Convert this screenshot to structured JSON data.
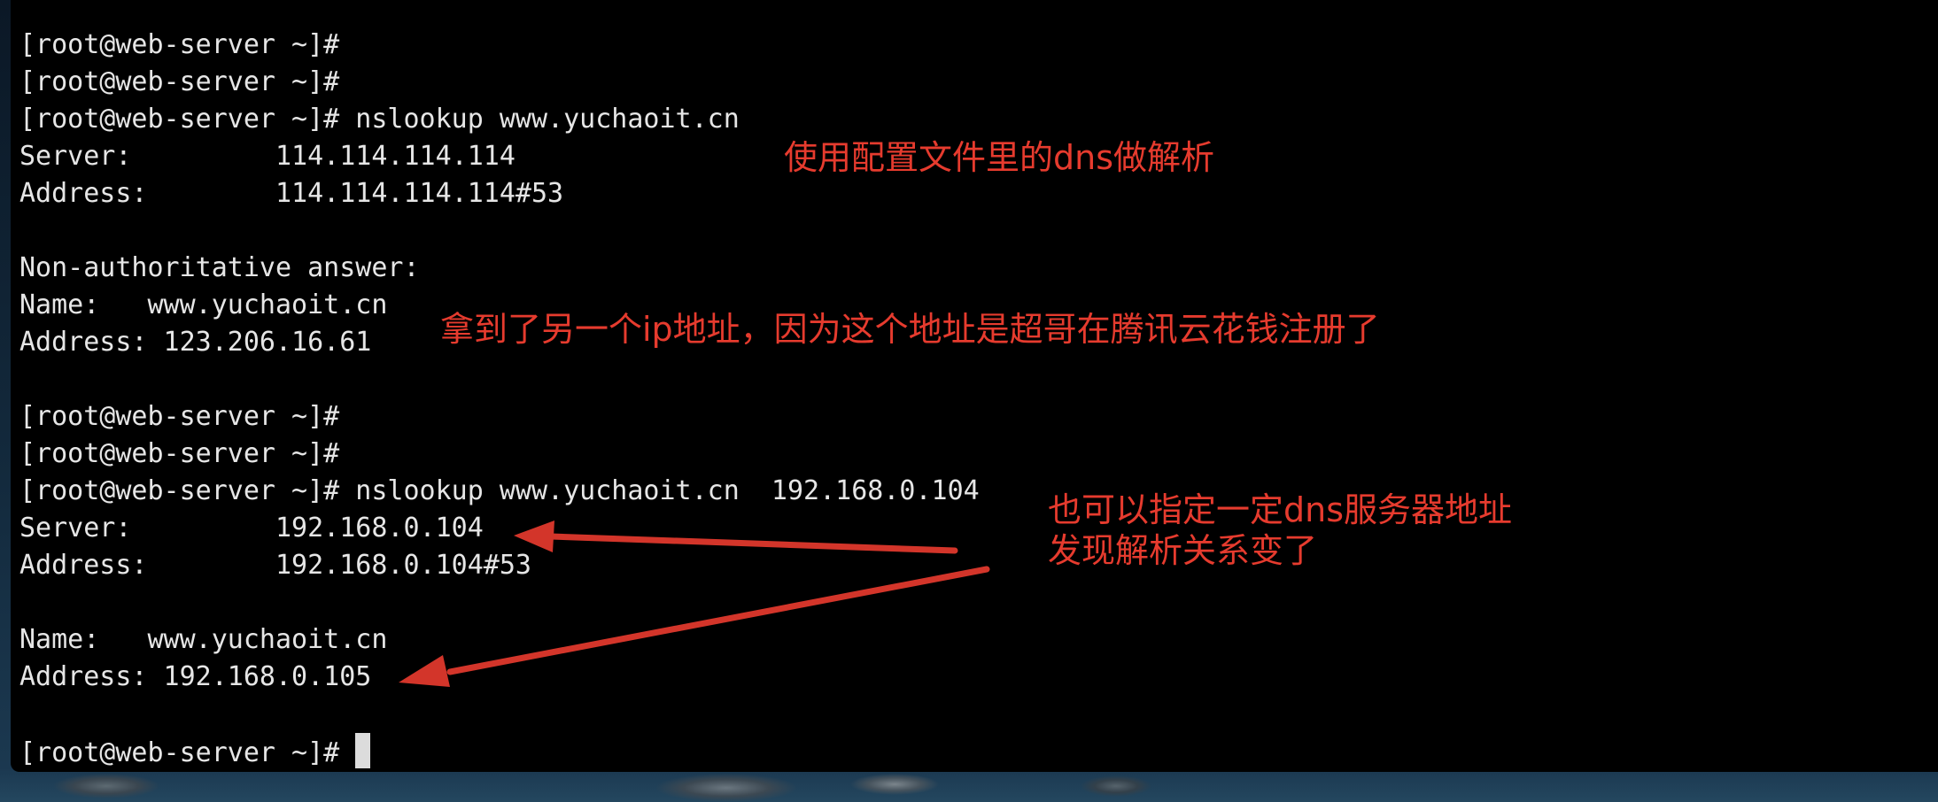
{
  "terminal": {
    "prompt": "[root@web-server ~]#",
    "lines": [
      "[root@web-server ~]#",
      "[root@web-server ~]#",
      "[root@web-server ~]# nslookup www.yuchaoit.cn",
      "Server:\t\t114.114.114.114",
      "Address:\t114.114.114.114#53",
      "",
      "Non-authoritative answer:",
      "Name:\twww.yuchaoit.cn",
      "Address: 123.206.16.61",
      "",
      "[root@web-server ~]#",
      "[root@web-server ~]#",
      "[root@web-server ~]# nslookup www.yuchaoit.cn  192.168.0.104",
      "Server:\t\t192.168.0.104",
      "Address:\t192.168.0.104#53",
      "",
      "Name:\twww.yuchaoit.cn",
      "Address: 192.168.0.105",
      ""
    ]
  },
  "annotations": {
    "note1": "使用配置文件里的dns做解析",
    "note2": "拿到了另一个ip地址，因为这个地址是超哥在腾讯云花钱注册了",
    "note3_line1": "也可以指定一定dns服务器地址",
    "note3_line2": "发现解析关系变了",
    "color": "#e63b2e"
  }
}
